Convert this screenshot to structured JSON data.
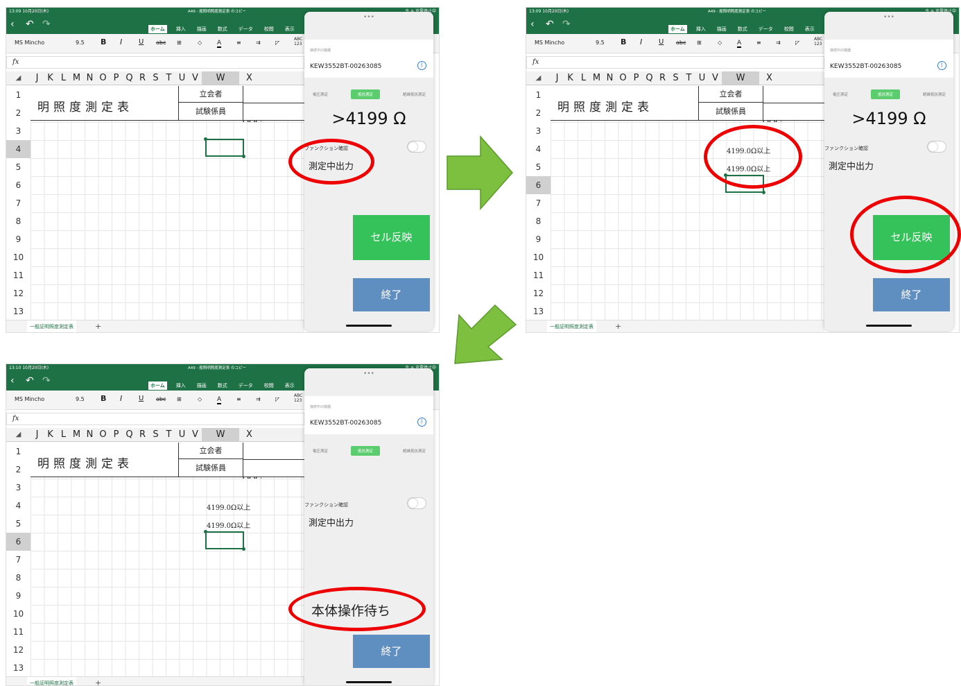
{
  "screenshots": [
    {
      "id": "s1",
      "status": {
        "clock": "13:09 10月20日(木)",
        "doc": "A49 - 般照明照度測定表 のコピー",
        "battery": "令 ⊕ 充電停止中"
      },
      "tabs": [
        "ホーム",
        "挿入",
        "描画",
        "数式",
        "データ",
        "校閲",
        "表示"
      ],
      "font": "MS Mincho",
      "font_size": "9.5",
      "columns": [
        "J",
        "K",
        "L",
        "M",
        "N",
        "O",
        "P",
        "Q",
        "R",
        "S",
        "T",
        "U",
        "V"
      ],
      "col_w": "W",
      "col_tail": "X Y Z AAA",
      "rows": [
        "1",
        "2",
        "3",
        "4",
        "5",
        "6",
        "7",
        "8",
        "9",
        "10",
        "11",
        "12",
        "13"
      ],
      "selected_row": "4",
      "title": "明照度測定表",
      "box1": "立会者",
      "box2": "試験係員",
      "cells": [],
      "sheet_tab": "一般証明照度測定表",
      "panel": {
        "device_label": "接続中の機器",
        "device": "KEW3552BT-00263085",
        "modes": [
          "電圧測定",
          "抵抗測定",
          "絶縁抵抗測定"
        ],
        "reading": ">4199 Ω",
        "function_label": "ファンクション確認",
        "state": "測定中出力",
        "wait": "",
        "reflect_button": "セル反映",
        "end_button": "終了"
      }
    },
    {
      "id": "s2",
      "status": {
        "clock": "13:09 10月20日(木)",
        "doc": "A49 - 般照明照度測定表 のコピー",
        "battery": "令 ⊕ 充電停止中"
      },
      "tabs": [
        "ホーム",
        "挿入",
        "描画",
        "数式",
        "データ",
        "校閲",
        "表示"
      ],
      "font": "MS Mincho",
      "font_size": "9.5",
      "columns": [
        "J",
        "K",
        "L",
        "M",
        "N",
        "O",
        "P",
        "Q",
        "R",
        "S",
        "T",
        "U",
        "V"
      ],
      "col_w": "W",
      "col_tail": "X Y Z AAA",
      "rows": [
        "1",
        "2",
        "3",
        "4",
        "5",
        "6",
        "7",
        "8",
        "9",
        "10",
        "11",
        "12",
        "13"
      ],
      "selected_row": "6",
      "title": "明照度測定表",
      "box1": "立会者",
      "box2": "試験係員",
      "cells": [
        "4199.0Ω以上",
        "4199.0Ω以上"
      ],
      "sheet_tab": "一般証明照度測定表",
      "panel": {
        "device_label": "接続中の機器",
        "device": "KEW3552BT-00263085",
        "modes": [
          "電圧測定",
          "抵抗測定",
          "絶縁抵抗測定"
        ],
        "reading": ">4199 Ω",
        "function_label": "ファンクション確認",
        "state": "測定中出力",
        "wait": "",
        "reflect_button": "セル反映",
        "end_button": "終了"
      }
    },
    {
      "id": "s3",
      "status": {
        "clock": "13:10 10月20日(木)",
        "doc": "A49 - 般照明照度測定表 のコピー",
        "battery": "令 ⊕ 充電停止中"
      },
      "tabs": [
        "ホーム",
        "挿入",
        "描画",
        "数式",
        "データ",
        "校閲",
        "表示"
      ],
      "font": "MS Mincho",
      "font_size": "9.5",
      "columns": [
        "J",
        "K",
        "L",
        "M",
        "N",
        "O",
        "P",
        "Q",
        "R",
        "S",
        "T",
        "U",
        "V"
      ],
      "col_w": "W",
      "col_tail": "X Y Z AAA",
      "rows": [
        "1",
        "2",
        "3",
        "4",
        "5",
        "6",
        "7",
        "8",
        "9",
        "10",
        "11",
        "12",
        "13"
      ],
      "selected_row": "6",
      "title": "明照度測定表",
      "box1": "立会者",
      "box2": "試験係員",
      "cells": [
        "4199.0Ω以上",
        "4199.0Ω以上"
      ],
      "sheet_tab": "一般証明照度測定表",
      "panel": {
        "device_label": "接続中の機器",
        "device": "KEW3552BT-00263085",
        "modes": [
          "電圧測定",
          "抵抗測定",
          "絶縁抵抗測定"
        ],
        "reading": "",
        "function_label": "ファンクション確認",
        "state": "測定中出力",
        "wait": "本体操作待ち",
        "reflect_button": "",
        "end_button": "終了"
      }
    }
  ],
  "colors": {
    "excel_green": "#1e7145",
    "button_green": "#35c25a",
    "button_blue": "#5f8fc0",
    "highlight_red": "#ee0000",
    "arrow_green": "#7dc040"
  }
}
